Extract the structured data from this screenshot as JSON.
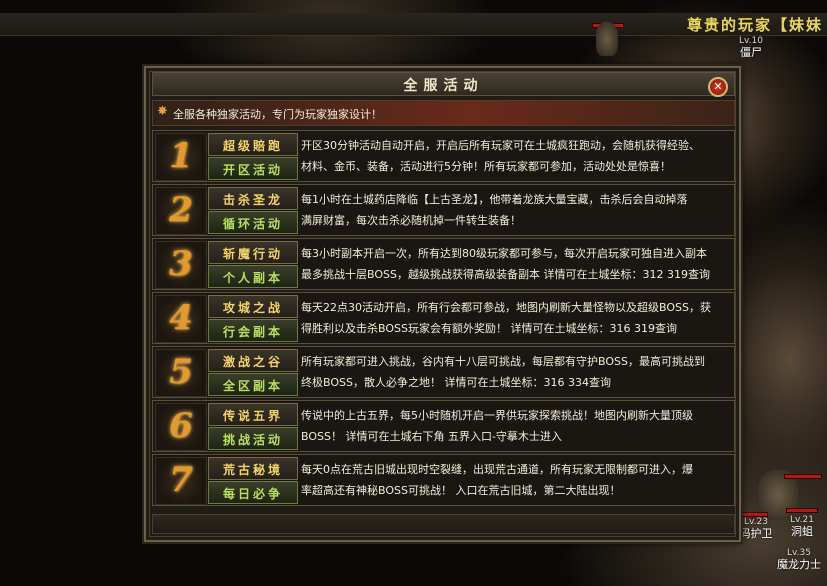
{
  "top_title": "尊贵的玩家【妹妹",
  "npcs": [
    {
      "level": "Lv.10",
      "name": "僵尸"
    },
    {
      "level": "Lv.23",
      "name": "码护卫"
    },
    {
      "level": "Lv.21",
      "name": "洞蛆"
    },
    {
      "level": "Lv.35",
      "name": "魔龙力士"
    }
  ],
  "dialog": {
    "title": "全服活动",
    "close_icon": "close-icon",
    "intro": "全服各种独家活动，专门为玩家独家设计！",
    "activities": [
      {
        "num": "1",
        "name": "超级賠跑",
        "category": "开区活动",
        "lines": [
          "开区30分钟活动自动开启，开启后所有玩家可在土城疯狂跑动，会随机获得经验、",
          "材料、金币、装备，活动进行5分钟！所有玩家都可参加，活动处处是惊喜！"
        ]
      },
      {
        "num": "2",
        "name": "击杀圣龙",
        "category": "循环活动",
        "lines": [
          "每1小时在土城药店降临【上古圣龙】，他带着龙族大量宝藏，击杀后会自动掉落",
          "满屏财富，每次击杀必随机掉一件转生装备！"
        ]
      },
      {
        "num": "3",
        "name": "斩魔行动",
        "category": "个人副本",
        "lines": [
          "每3小时副本开启一次，所有达到80级玩家都可参与，每次开启玩家可独自进入副本",
          "最多挑战十层BOSS，越级挑战获得高级装备副本   详情可在土城坐标：312 319查询"
        ]
      },
      {
        "num": "4",
        "name": "攻城之战",
        "category": "行会副本",
        "lines": [
          "每天22点30活动开启，所有行会都可参战，地图内刷新大量怪物以及超级BOSS，获",
          "得胜利以及击杀BOSS玩家会有额外奖励！          详情可在土城坐标：316 319查询"
        ]
      },
      {
        "num": "5",
        "name": "激战之谷",
        "category": "全区副本",
        "lines": [
          "所有玩家都可进入挑战，谷内有十八层可挑战，每层都有守护BOSS，最高可挑战到",
          "终极BOSS，散人必争之地！                  详情可在土城坐标：316 334查询"
        ]
      },
      {
        "num": "6",
        "name": "传说五界",
        "category": "挑战活动",
        "lines": [
          "传说中的上古五界，每5小时随机开启一界供玩家探索挑战！地图内刷新大量顶级",
          "BOSS！                    详情可在土城右下角 五界入口-守摹木士进入"
        ]
      },
      {
        "num": "7",
        "name": "荒古秘境",
        "category": "每日必争",
        "lines": [
          "每天0点在荒古旧城出现时空裂缝，出现荒古通道，所有玩家无限制都可进入，爆",
          "率超高还有神秘BOSS可挑战！          入口在荒古旧城，第二大陆出现！"
        ]
      }
    ]
  }
}
